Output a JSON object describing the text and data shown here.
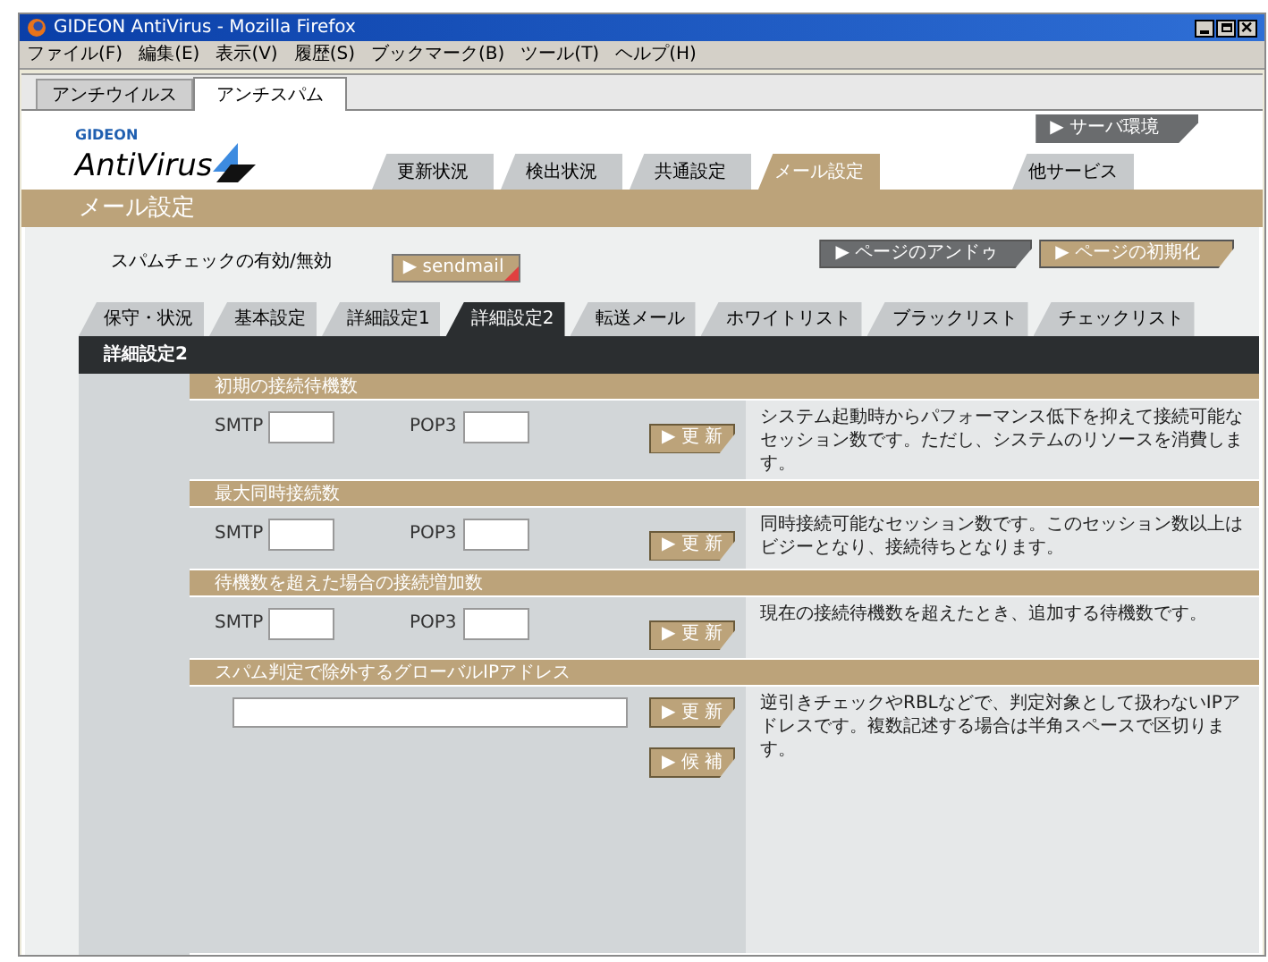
{
  "window": {
    "title": "GIDEON AntiVirus - Mozilla Firefox"
  },
  "menu": [
    "ファイル(F)",
    "編集(E)",
    "表示(V)",
    "履歴(S)",
    "ブックマーク(B)",
    "ツール(T)",
    "ヘルプ(H)"
  ],
  "browser_tabs": [
    {
      "label": "アンチウイルス",
      "selected": false
    },
    {
      "label": "アンチスパム",
      "selected": true
    }
  ],
  "logo": {
    "brand": "GIDEON",
    "product": "AntiVirus"
  },
  "server_button": "▶ サーバ環境",
  "nav_tabs": [
    {
      "label": "更新状況",
      "selected": false
    },
    {
      "label": "検出状況",
      "selected": false
    },
    {
      "label": "共通設定",
      "selected": false
    },
    {
      "label": "メール設定",
      "selected": true
    },
    {
      "label": "他サービス",
      "selected": false
    }
  ],
  "page_title": "メール設定",
  "spam_check": {
    "label": "スパムチェックの有効/無効",
    "button": "▶ sendmail"
  },
  "page_buttons": [
    {
      "label": "▶ ページのアンドゥ",
      "kind": "dark"
    },
    {
      "label": "▶ ページの初期化",
      "kind": "tan"
    }
  ],
  "sub_tabs": [
    {
      "label": "保守・状況",
      "selected": false
    },
    {
      "label": "基本設定",
      "selected": false
    },
    {
      "label": "詳細設定1",
      "selected": false
    },
    {
      "label": "詳細設定2",
      "selected": true
    },
    {
      "label": "転送メール",
      "selected": false
    },
    {
      "label": "ホワイトリスト",
      "selected": false
    },
    {
      "label": "ブラックリスト",
      "selected": false
    },
    {
      "label": "チェックリスト",
      "selected": false
    }
  ],
  "section_title": "詳細設定2",
  "sections": [
    {
      "kind": "pair",
      "title": "初期の接続待機数",
      "fields": [
        "SMTP",
        "POP3"
      ],
      "buttons": [
        "▶ 更 新"
      ],
      "description": "システム起動時からパフォーマンス低下を抑えて接続可能なセッション数です。ただし、システムのリソースを消費します。"
    },
    {
      "kind": "pair",
      "title": "最大同時接続数",
      "fields": [
        "SMTP",
        "POP3"
      ],
      "buttons": [
        "▶ 更 新"
      ],
      "description": "同時接続可能なセッション数です。このセッション数以上はビジーとなり、接続待ちとなります。"
    },
    {
      "kind": "pair",
      "title": "待機数を超えた場合の接続増加数",
      "fields": [
        "SMTP",
        "POP3"
      ],
      "buttons": [
        "▶ 更 新"
      ],
      "description": "現在の接続待機数を超えたとき、追加する待機数です。"
    },
    {
      "kind": "address",
      "title": "スパム判定で除外するグローバルIPアドレス",
      "buttons": [
        "▶ 更 新",
        "▶ 候 補"
      ],
      "description": "逆引きチェックやRBLなどで、判定対象として扱わないIPアドレスです。複数記述する場合は半角スペースで区切ります。"
    }
  ]
}
